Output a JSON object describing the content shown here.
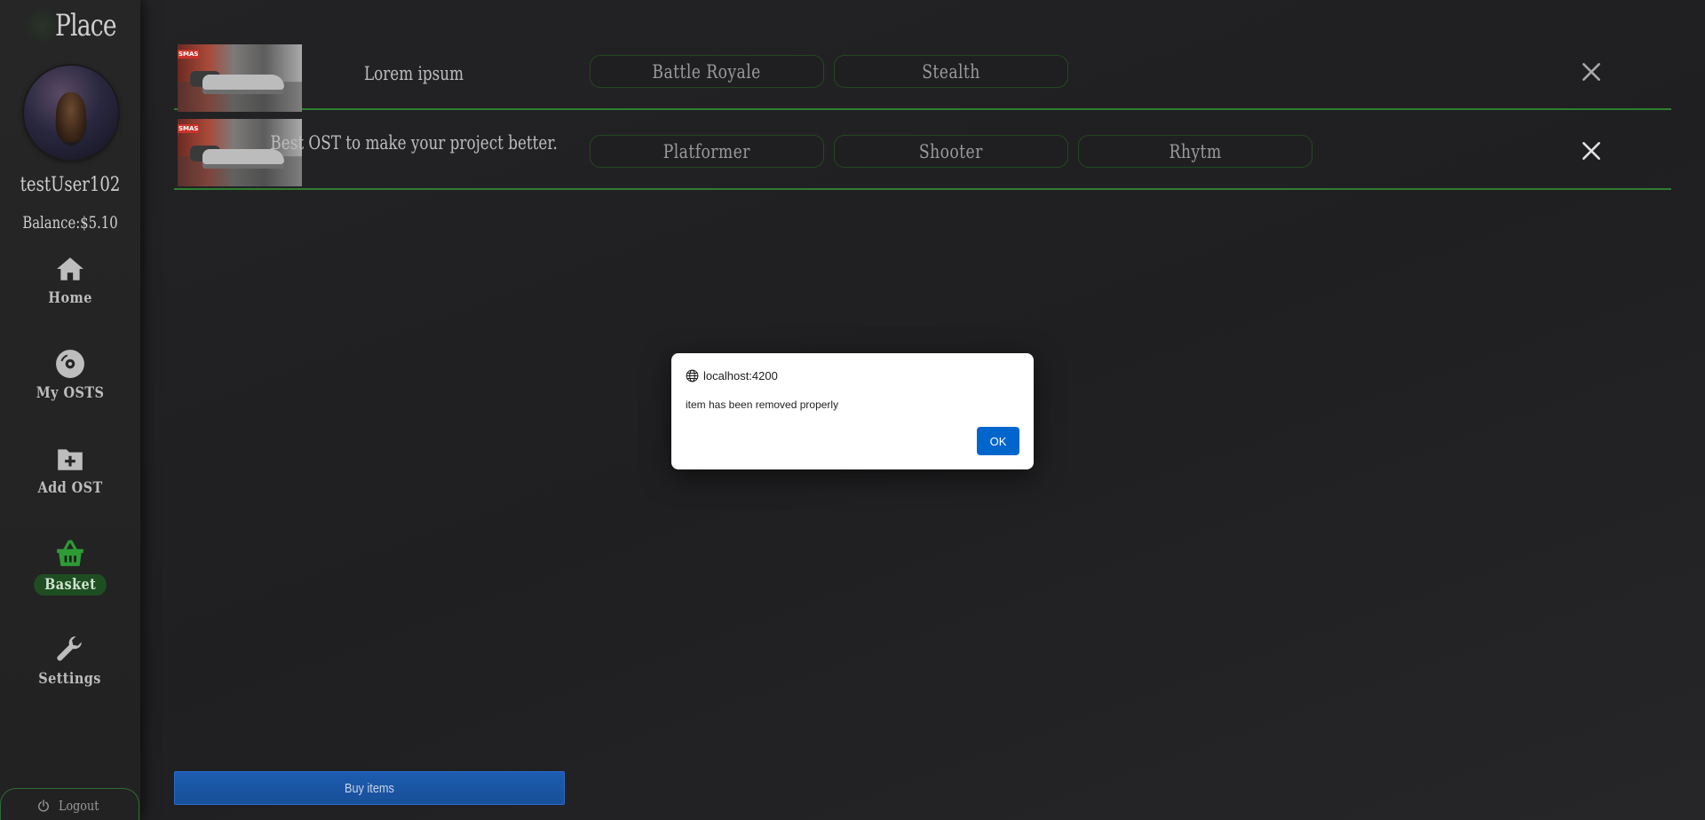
{
  "app": {
    "brand": "Place"
  },
  "sidebar": {
    "username": "testUser102",
    "balance": "Balance:$5.10",
    "nav": [
      {
        "label": "Home",
        "icon": "home-icon"
      },
      {
        "label": "My OSTS",
        "icon": "disc-icon"
      },
      {
        "label": "Add OST",
        "icon": "folder-plus-icon"
      },
      {
        "label": "Basket",
        "icon": "basket-icon",
        "active": true
      },
      {
        "label": "Settings",
        "icon": "wrench-icon"
      }
    ],
    "logout": "Logout"
  },
  "basket": {
    "items": [
      {
        "title": "Lorem ipsum",
        "tags": [
          "Battle Royale",
          "Stealth"
        ]
      },
      {
        "title": "Best OST to make your project better.",
        "tags": [
          "Platformer",
          "Shooter",
          "Rhytm"
        ]
      }
    ],
    "buy_label": "Buy items"
  },
  "dialog": {
    "origin": "localhost:4200",
    "message": "item has been removed properly",
    "ok_label": "OK"
  },
  "colors": {
    "accent_green": "#2e7d32",
    "active_nav_bg": "#1f4d22",
    "buy_blue": "#1c5cb0",
    "dialog_ok_blue": "#0066cc"
  }
}
